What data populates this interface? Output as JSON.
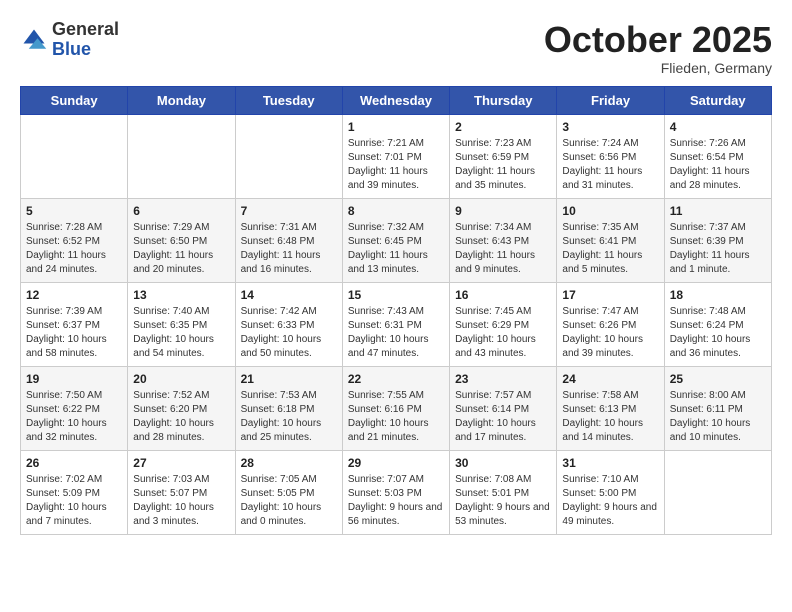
{
  "header": {
    "logo_general": "General",
    "logo_blue": "Blue",
    "month": "October 2025",
    "location": "Flieden, Germany"
  },
  "days_of_week": [
    "Sunday",
    "Monday",
    "Tuesday",
    "Wednesday",
    "Thursday",
    "Friday",
    "Saturday"
  ],
  "weeks": [
    [
      {
        "day": "",
        "sunrise": "",
        "sunset": "",
        "daylight": ""
      },
      {
        "day": "",
        "sunrise": "",
        "sunset": "",
        "daylight": ""
      },
      {
        "day": "",
        "sunrise": "",
        "sunset": "",
        "daylight": ""
      },
      {
        "day": "1",
        "sunrise": "Sunrise: 7:21 AM",
        "sunset": "Sunset: 7:01 PM",
        "daylight": "Daylight: 11 hours and 39 minutes."
      },
      {
        "day": "2",
        "sunrise": "Sunrise: 7:23 AM",
        "sunset": "Sunset: 6:59 PM",
        "daylight": "Daylight: 11 hours and 35 minutes."
      },
      {
        "day": "3",
        "sunrise": "Sunrise: 7:24 AM",
        "sunset": "Sunset: 6:56 PM",
        "daylight": "Daylight: 11 hours and 31 minutes."
      },
      {
        "day": "4",
        "sunrise": "Sunrise: 7:26 AM",
        "sunset": "Sunset: 6:54 PM",
        "daylight": "Daylight: 11 hours and 28 minutes."
      }
    ],
    [
      {
        "day": "5",
        "sunrise": "Sunrise: 7:28 AM",
        "sunset": "Sunset: 6:52 PM",
        "daylight": "Daylight: 11 hours and 24 minutes."
      },
      {
        "day": "6",
        "sunrise": "Sunrise: 7:29 AM",
        "sunset": "Sunset: 6:50 PM",
        "daylight": "Daylight: 11 hours and 20 minutes."
      },
      {
        "day": "7",
        "sunrise": "Sunrise: 7:31 AM",
        "sunset": "Sunset: 6:48 PM",
        "daylight": "Daylight: 11 hours and 16 minutes."
      },
      {
        "day": "8",
        "sunrise": "Sunrise: 7:32 AM",
        "sunset": "Sunset: 6:45 PM",
        "daylight": "Daylight: 11 hours and 13 minutes."
      },
      {
        "day": "9",
        "sunrise": "Sunrise: 7:34 AM",
        "sunset": "Sunset: 6:43 PM",
        "daylight": "Daylight: 11 hours and 9 minutes."
      },
      {
        "day": "10",
        "sunrise": "Sunrise: 7:35 AM",
        "sunset": "Sunset: 6:41 PM",
        "daylight": "Daylight: 11 hours and 5 minutes."
      },
      {
        "day": "11",
        "sunrise": "Sunrise: 7:37 AM",
        "sunset": "Sunset: 6:39 PM",
        "daylight": "Daylight: 11 hours and 1 minute."
      }
    ],
    [
      {
        "day": "12",
        "sunrise": "Sunrise: 7:39 AM",
        "sunset": "Sunset: 6:37 PM",
        "daylight": "Daylight: 10 hours and 58 minutes."
      },
      {
        "day": "13",
        "sunrise": "Sunrise: 7:40 AM",
        "sunset": "Sunset: 6:35 PM",
        "daylight": "Daylight: 10 hours and 54 minutes."
      },
      {
        "day": "14",
        "sunrise": "Sunrise: 7:42 AM",
        "sunset": "Sunset: 6:33 PM",
        "daylight": "Daylight: 10 hours and 50 minutes."
      },
      {
        "day": "15",
        "sunrise": "Sunrise: 7:43 AM",
        "sunset": "Sunset: 6:31 PM",
        "daylight": "Daylight: 10 hours and 47 minutes."
      },
      {
        "day": "16",
        "sunrise": "Sunrise: 7:45 AM",
        "sunset": "Sunset: 6:29 PM",
        "daylight": "Daylight: 10 hours and 43 minutes."
      },
      {
        "day": "17",
        "sunrise": "Sunrise: 7:47 AM",
        "sunset": "Sunset: 6:26 PM",
        "daylight": "Daylight: 10 hours and 39 minutes."
      },
      {
        "day": "18",
        "sunrise": "Sunrise: 7:48 AM",
        "sunset": "Sunset: 6:24 PM",
        "daylight": "Daylight: 10 hours and 36 minutes."
      }
    ],
    [
      {
        "day": "19",
        "sunrise": "Sunrise: 7:50 AM",
        "sunset": "Sunset: 6:22 PM",
        "daylight": "Daylight: 10 hours and 32 minutes."
      },
      {
        "day": "20",
        "sunrise": "Sunrise: 7:52 AM",
        "sunset": "Sunset: 6:20 PM",
        "daylight": "Daylight: 10 hours and 28 minutes."
      },
      {
        "day": "21",
        "sunrise": "Sunrise: 7:53 AM",
        "sunset": "Sunset: 6:18 PM",
        "daylight": "Daylight: 10 hours and 25 minutes."
      },
      {
        "day": "22",
        "sunrise": "Sunrise: 7:55 AM",
        "sunset": "Sunset: 6:16 PM",
        "daylight": "Daylight: 10 hours and 21 minutes."
      },
      {
        "day": "23",
        "sunrise": "Sunrise: 7:57 AM",
        "sunset": "Sunset: 6:14 PM",
        "daylight": "Daylight: 10 hours and 17 minutes."
      },
      {
        "day": "24",
        "sunrise": "Sunrise: 7:58 AM",
        "sunset": "Sunset: 6:13 PM",
        "daylight": "Daylight: 10 hours and 14 minutes."
      },
      {
        "day": "25",
        "sunrise": "Sunrise: 8:00 AM",
        "sunset": "Sunset: 6:11 PM",
        "daylight": "Daylight: 10 hours and 10 minutes."
      }
    ],
    [
      {
        "day": "26",
        "sunrise": "Sunrise: 7:02 AM",
        "sunset": "Sunset: 5:09 PM",
        "daylight": "Daylight: 10 hours and 7 minutes."
      },
      {
        "day": "27",
        "sunrise": "Sunrise: 7:03 AM",
        "sunset": "Sunset: 5:07 PM",
        "daylight": "Daylight: 10 hours and 3 minutes."
      },
      {
        "day": "28",
        "sunrise": "Sunrise: 7:05 AM",
        "sunset": "Sunset: 5:05 PM",
        "daylight": "Daylight: 10 hours and 0 minutes."
      },
      {
        "day": "29",
        "sunrise": "Sunrise: 7:07 AM",
        "sunset": "Sunset: 5:03 PM",
        "daylight": "Daylight: 9 hours and 56 minutes."
      },
      {
        "day": "30",
        "sunrise": "Sunrise: 7:08 AM",
        "sunset": "Sunset: 5:01 PM",
        "daylight": "Daylight: 9 hours and 53 minutes."
      },
      {
        "day": "31",
        "sunrise": "Sunrise: 7:10 AM",
        "sunset": "Sunset: 5:00 PM",
        "daylight": "Daylight: 9 hours and 49 minutes."
      },
      {
        "day": "",
        "sunrise": "",
        "sunset": "",
        "daylight": ""
      }
    ]
  ]
}
